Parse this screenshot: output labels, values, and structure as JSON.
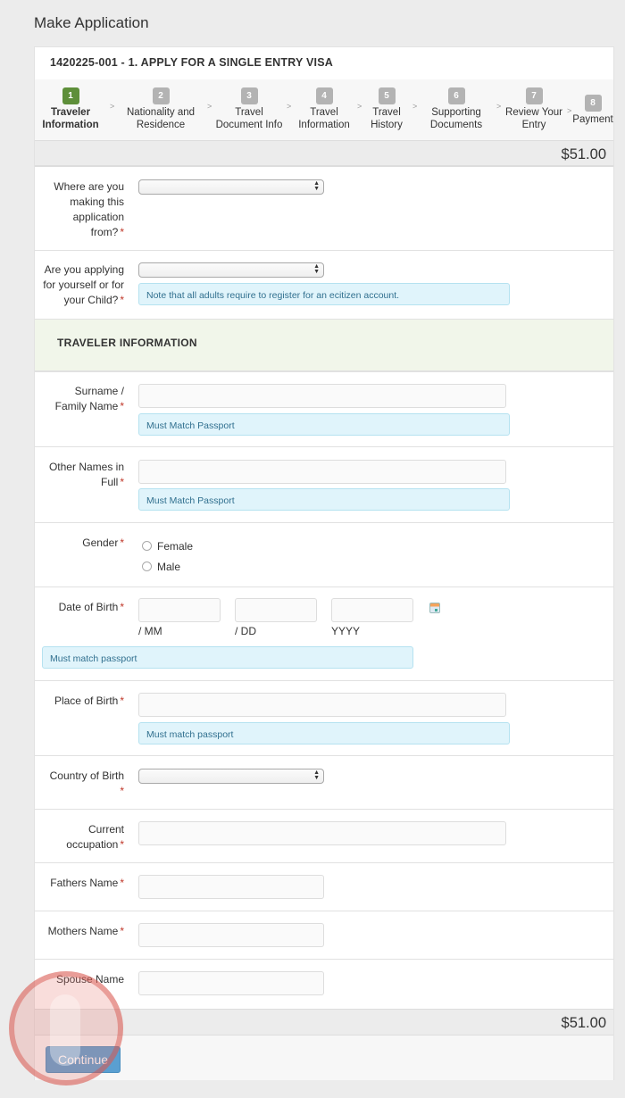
{
  "page": {
    "title": "Make Application"
  },
  "application": {
    "title": "1420225-001 - 1. APPLY FOR A SINGLE ENTRY VISA"
  },
  "stepper": {
    "separator": ">",
    "steps": [
      {
        "number": "1",
        "label_line1": "Traveler",
        "label_line2": "Information",
        "active": true
      },
      {
        "number": "2",
        "label_line1": "Nationality and",
        "label_line2": "Residence",
        "active": false
      },
      {
        "number": "3",
        "label_line1": "Travel",
        "label_line2": "Document Info",
        "active": false
      },
      {
        "number": "4",
        "label_line1": "Travel",
        "label_line2": "Information",
        "active": false
      },
      {
        "number": "5",
        "label_line1": "Travel",
        "label_line2": "History",
        "active": false
      },
      {
        "number": "6",
        "label_line1": "Supporting",
        "label_line2": "Documents",
        "active": false
      },
      {
        "number": "7",
        "label_line1": "Review Your",
        "label_line2": "Entry",
        "active": false
      },
      {
        "number": "8",
        "label_line1": "Payment",
        "label_line2": "",
        "active": false
      }
    ]
  },
  "price": {
    "top": "$51.00",
    "bottom": "$51.00"
  },
  "form": {
    "required_marker": "*",
    "application_from": {
      "label_lines": [
        "Where are you",
        "making this",
        "application",
        "from?"
      ],
      "value": ""
    },
    "applying_for": {
      "label_lines": [
        "Are you applying",
        "for yourself or for",
        "your Child?"
      ],
      "value": "",
      "note": "Note that all adults require to register for an ecitizen account."
    },
    "section_title": "TRAVELER INFORMATION",
    "surname": {
      "label_lines": [
        "Surname /",
        "Family Name"
      ],
      "value": "",
      "note": "Must Match Passport"
    },
    "other_names": {
      "label_lines": [
        "Other Names in",
        "Full"
      ],
      "value": "",
      "note": "Must Match Passport"
    },
    "gender": {
      "label": "Gender",
      "options": [
        "Female",
        "Male"
      ],
      "selected": null
    },
    "dob": {
      "label": "Date of Birth",
      "mm_label": "/ MM",
      "dd_label": "/ DD",
      "yyyy_label": "YYYY",
      "mm": "",
      "dd": "",
      "yyyy": "",
      "note": "Must match passport",
      "icon": "calendar-icon"
    },
    "place_of_birth": {
      "label": "Place of Birth",
      "value": "",
      "note": "Must match passport"
    },
    "country_of_birth": {
      "label": "Country of Birth",
      "value": ""
    },
    "occupation": {
      "label_lines": [
        "Current",
        "occupation"
      ],
      "value": ""
    },
    "fathers_name": {
      "label": "Fathers Name",
      "value": ""
    },
    "mothers_name": {
      "label": "Mothers Name",
      "value": ""
    },
    "spouse_name": {
      "label": "Spouse Name",
      "value": ""
    }
  },
  "actions": {
    "continue_label": "Continue"
  },
  "colors": {
    "active_step": "#5e8f3a",
    "inactive_step": "#b3b3b3",
    "note_bg": "#e0f4fb",
    "note_text": "#31708f",
    "section_bg": "#f1f6ea",
    "continue_bg": "#5a9fd1",
    "required": "#c0392b"
  }
}
